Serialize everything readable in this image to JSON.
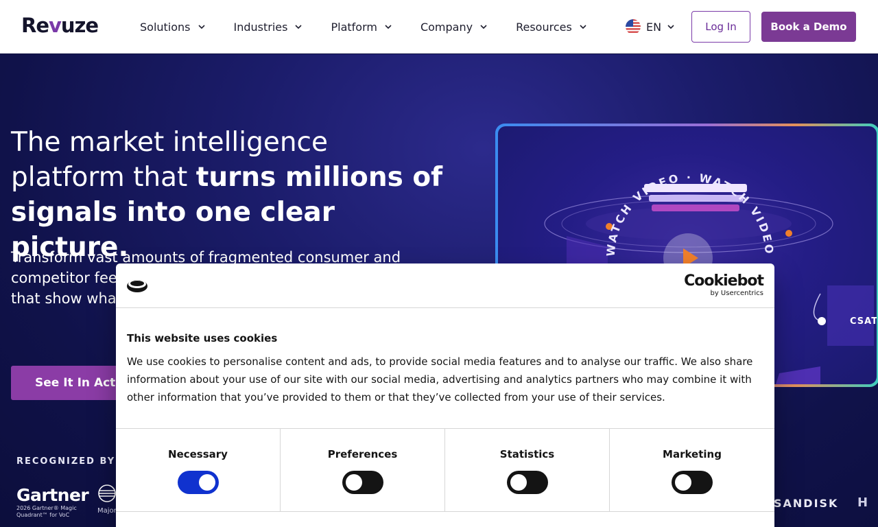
{
  "header": {
    "logo_text_pre": "Re",
    "logo_text_v": "v",
    "logo_text_post": "uze",
    "nav": [
      {
        "label": "Solutions"
      },
      {
        "label": "Industries"
      },
      {
        "label": "Platform"
      },
      {
        "label": "Company"
      },
      {
        "label": "Resources"
      }
    ],
    "language": "EN",
    "login_label": "Log In",
    "demo_label": "Book a Demo"
  },
  "hero": {
    "title_plain": "The market intelligence platform that ",
    "title_bold": "turns millions of signals into one clear picture.",
    "subtitle": "Transform vast amounts of fragmented consumer and competitor feedback into actionable real-time insights that show what to fix, what to improve",
    "cta_label": "See It In Action",
    "recognized_label": "RECOGNIZED BY ANALYSTS",
    "gartner_name": "Gartner",
    "gartner_sub": "2026 Gartner® Magic Quadrant™ for VoC",
    "major_text": "Major VoC",
    "video_text": "WATCH VIDEO · WATCH VIDEO · WATCH VIDEO",
    "video_csat": "CSAT",
    "client_logo_1": "SANDISK",
    "client_logo_2": "H"
  },
  "cookie_banner": {
    "brand": "Cookiebot",
    "brand_by": "by Usercentrics",
    "title": "This website uses cookies",
    "text": "We use cookies to personalise content and ads, to provide social media features and to analyse our traffic. We also share information about your use of our site with our social media, advertising and analytics partners who may combine it with other information that you’ve provided to them or that they’ve collected from your use of their services.",
    "categories": [
      {
        "label": "Necessary",
        "enabled": true
      },
      {
        "label": "Preferences",
        "enabled": false
      },
      {
        "label": "Statistics",
        "enabled": false
      },
      {
        "label": "Marketing",
        "enabled": false
      }
    ]
  },
  "colors": {
    "brand_purple": "#7b3a94",
    "hero_bg": "#1b1c6a",
    "toggle_on": "#1032cf",
    "toggle_off": "#141414",
    "play_accent": "#f07f2a"
  },
  "icons": {
    "chevron": "chevron-down-icon",
    "flag": "us-flag-icon",
    "play": "play-icon",
    "cookie": "cookie-icon"
  }
}
